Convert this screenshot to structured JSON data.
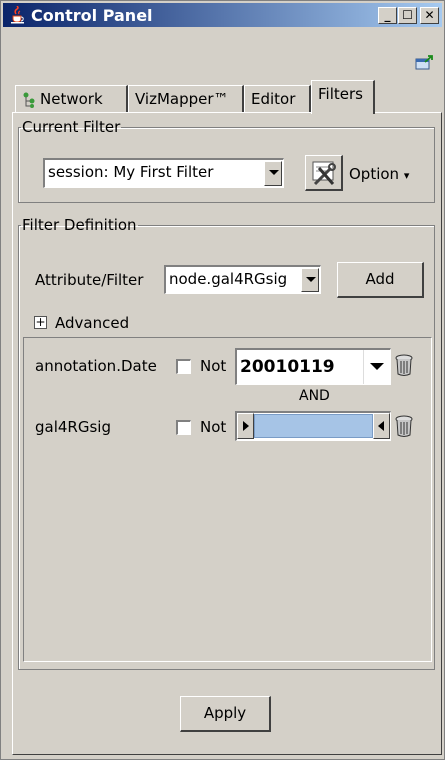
{
  "window": {
    "title": "Control Panel",
    "title_icon": "java-cup-icon",
    "controls": {
      "minimize": "_",
      "maximize": "☐",
      "close": "✕"
    }
  },
  "tabs": [
    {
      "label": "Network",
      "icon": "network-tree-icon",
      "active": false
    },
    {
      "label": "VizMapper™",
      "active": false
    },
    {
      "label": "Editor",
      "active": false
    },
    {
      "label": "Filters",
      "active": true
    }
  ],
  "current_filter": {
    "legend": "Current Filter",
    "selected": "session: My First Filter",
    "option_label": "Option",
    "option_arrow": "▾"
  },
  "filter_definition": {
    "legend": "Filter Definition",
    "attribute_label": "Attribute/Filter",
    "attribute_selected": "node.gal4RGsig",
    "add_label": "Add",
    "advanced_toggle": "+",
    "advanced_label": "Advanced",
    "rows": [
      {
        "name": "annotation.Date",
        "not_label": "Not",
        "not_checked": false,
        "value": "20010119"
      },
      {
        "name": "gal4RGsig",
        "not_label": "Not",
        "not_checked": false,
        "range_low": 0.0,
        "range_high": 1.0
      }
    ],
    "connector": "AND"
  },
  "apply_label": "Apply"
}
